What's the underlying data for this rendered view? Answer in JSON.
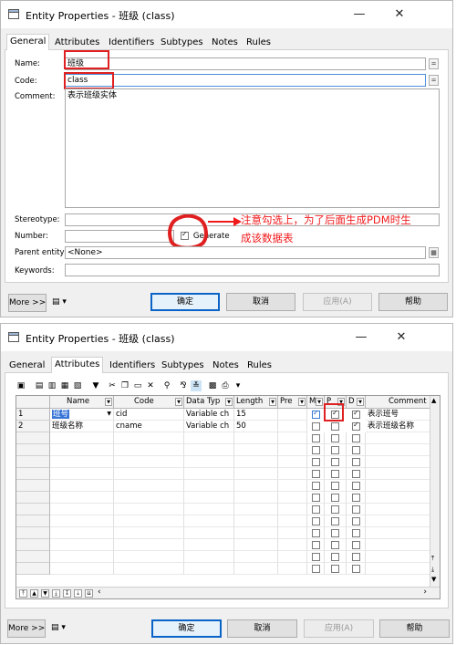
{
  "window1": {
    "title": "Entity Properties - 班级 (class)",
    "tabs": [
      "General",
      "Attributes",
      "Identifiers",
      "Subtypes",
      "Notes",
      "Rules"
    ],
    "labels": {
      "name": "Name:",
      "code": "Code:",
      "comment": "Comment:",
      "stereotype": "Stereotype:",
      "number": "Number:",
      "parent_entity": "Parent entity:",
      "keywords": "Keywords:"
    },
    "values": {
      "name": "班级",
      "code": "class",
      "comment": "表示班级实体",
      "parent_entity": "<None>"
    },
    "eq_button": "=",
    "generate_label": "Generate",
    "generate_checked": true,
    "annotation": {
      "line1": "注意勾选上，为了后面生成PDM时生",
      "line2": "成该数据表",
      "color": "#f2191b"
    },
    "buttons": {
      "more": "More >>",
      "ok": "确定",
      "cancel": "取消",
      "apply": "应用(A)",
      "help": "帮助"
    }
  },
  "window2": {
    "title": "Entity Properties - 班级 (class)",
    "tabs": [
      "General",
      "Attributes",
      "Identifiers",
      "Subtypes",
      "Notes",
      "Rules"
    ],
    "grid": {
      "columns": [
        "Name",
        "Code",
        "Data Typ",
        "Length",
        "Pre",
        "M",
        "P",
        "D",
        "Comment"
      ],
      "rows": [
        {
          "num": "1",
          "name": "班号",
          "code": "cid",
          "type": "Variable ch",
          "length": "15",
          "m": true,
          "p": true,
          "d": true,
          "comment": "表示班号"
        },
        {
          "num": "2",
          "name": "班级名称",
          "code": "cname",
          "type": "Variable ch",
          "length": "50",
          "m": false,
          "p": false,
          "d": true,
          "comment": "表示班级名称"
        }
      ],
      "empty_rows": 14
    },
    "buttons": {
      "more": "More >>",
      "ok": "确定",
      "cancel": "取消",
      "apply": "应用(A)",
      "help": "帮助"
    }
  }
}
